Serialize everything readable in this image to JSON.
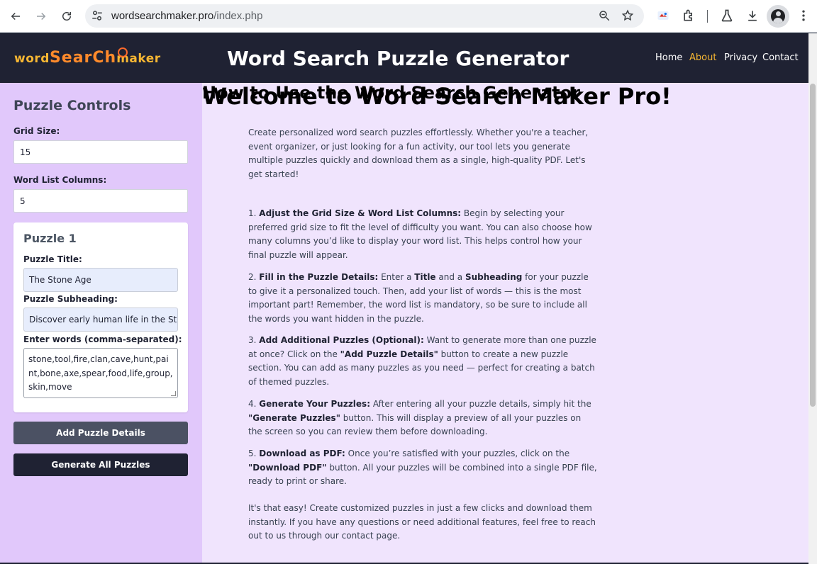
{
  "browser": {
    "url_domain": "wordsearchmaker.pro",
    "url_path": "/index.php"
  },
  "header": {
    "logo": {
      "part1": "word",
      "part2": "SearCh",
      "part3": "maker"
    },
    "title": "Word Search Puzzle Generator",
    "nav": [
      {
        "label": "Home",
        "active": false
      },
      {
        "label": "About",
        "active": true
      },
      {
        "label": "Privacy",
        "active": false
      },
      {
        "label": "Contact",
        "active": false
      }
    ]
  },
  "sidebar": {
    "heading": "Puzzle Controls",
    "grid_size_label": "Grid Size:",
    "grid_size_value": "15",
    "word_list_columns_label": "Word List Columns:",
    "word_list_columns_value": "5",
    "puzzle": {
      "title": "Puzzle 1",
      "title_label": "Puzzle Title:",
      "title_value": "The Stone Age",
      "subheading_label": "Puzzle Subheading:",
      "subheading_value": "Discover early human life in the Sto",
      "words_label": "Enter words (comma-separated):",
      "words_value": "stone,tool,fire,clan,cave,hunt,paint,bone,axe,spear,food,life,group,skin,move"
    },
    "add_button": "Add Puzzle Details",
    "generate_button": "Generate All Puzzles"
  },
  "main": {
    "heading": "Welcome to Word Search Maker Pro!",
    "intro": "Create personalized word search puzzles effortlessly. Whether you're a teacher, event organizer, or just looking for a fun activity, our tool lets you generate multiple puzzles quickly and download them as a single, high-quality PDF. Let's get started!",
    "howto_heading": "How to Use the Word Search Generator",
    "steps": [
      {
        "num": "1.",
        "title": "Adjust the Grid Size & Word List Columns:",
        "text": " Begin by selecting your preferred grid size to fit the level of difficulty you want. You can also choose how many columns you’d like to display your word list. This helps control how your final puzzle will appear."
      },
      {
        "num": "2.",
        "title": "Fill in the Puzzle Details:",
        "text_a": " Enter a ",
        "bold_a": "Title",
        "text_b": " and a ",
        "bold_b": "Subheading",
        "text_c": " for your puzzle to give it a personalized touch. Then, add your list of words — this is the most important part! Remember, the word list is mandatory, so be sure to include all the words you want hidden in the puzzle."
      },
      {
        "num": "3.",
        "title": "Add Additional Puzzles (Optional):",
        "text_a": " Want to generate more than one puzzle at once? Click on the ",
        "bold_a": "\"Add Puzzle Details\"",
        "text_b": " button to create a new puzzle section. You can add as many puzzles as you need — perfect for creating a batch of themed puzzles."
      },
      {
        "num": "4.",
        "title": "Generate Your Puzzles:",
        "text_a": " After entering all your puzzle details, simply hit the ",
        "bold_a": "\"Generate Puzzles\"",
        "text_b": " button. This will display a preview of all your puzzles on the screen so you can review them before downloading."
      },
      {
        "num": "5.",
        "title": "Download as PDF:",
        "text_a": " Once you’re satisfied with your puzzles, click on the ",
        "bold_a": "\"Download PDF\"",
        "text_b": " button. All your puzzles will be combined into a single PDF file, ready to print or share."
      }
    ],
    "closing": "It's that easy! Create customized puzzles in just a few clicks and download them instantly. If you have any questions or need additional features, feel free to reach out to us through our contact page."
  },
  "colors": {
    "header_bg": "#1f2233",
    "accent_gold": "#f7b733",
    "sidebar_bg": "#e1c8fb",
    "main_bg": "#f0e4fd",
    "heading_purple": "#6b1fc0"
  }
}
